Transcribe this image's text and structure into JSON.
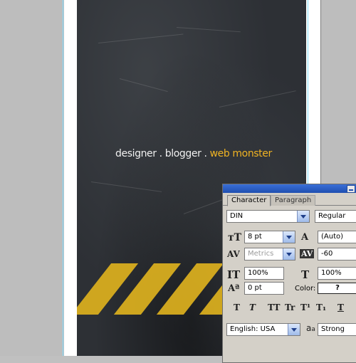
{
  "artwork": {
    "tagline_part1": "designer . blogger . ",
    "tagline_accent": "web monster",
    "accent_color": "#f0b323",
    "stripe_color": "#d8ad1f"
  },
  "character_panel": {
    "tabs": [
      "Character",
      "Paragraph"
    ],
    "active_tab": "Character",
    "font_family": "DIN",
    "font_style": "Regular",
    "font_size": "8 pt",
    "leading": "(Auto)",
    "kerning": "Metrics",
    "tracking": "-60",
    "vertical_scale": "100%",
    "horizontal_scale": "100%",
    "baseline_shift": "0 pt",
    "color_label": "Color:",
    "color_value": "?",
    "language": "English: USA",
    "antialiasing_label": "a",
    "antialiasing_sublabel": "a",
    "antialiasing": "Strong",
    "style_buttons": [
      "T",
      "T",
      "TT",
      "Tr",
      "T¹",
      "T₁",
      "T"
    ]
  }
}
